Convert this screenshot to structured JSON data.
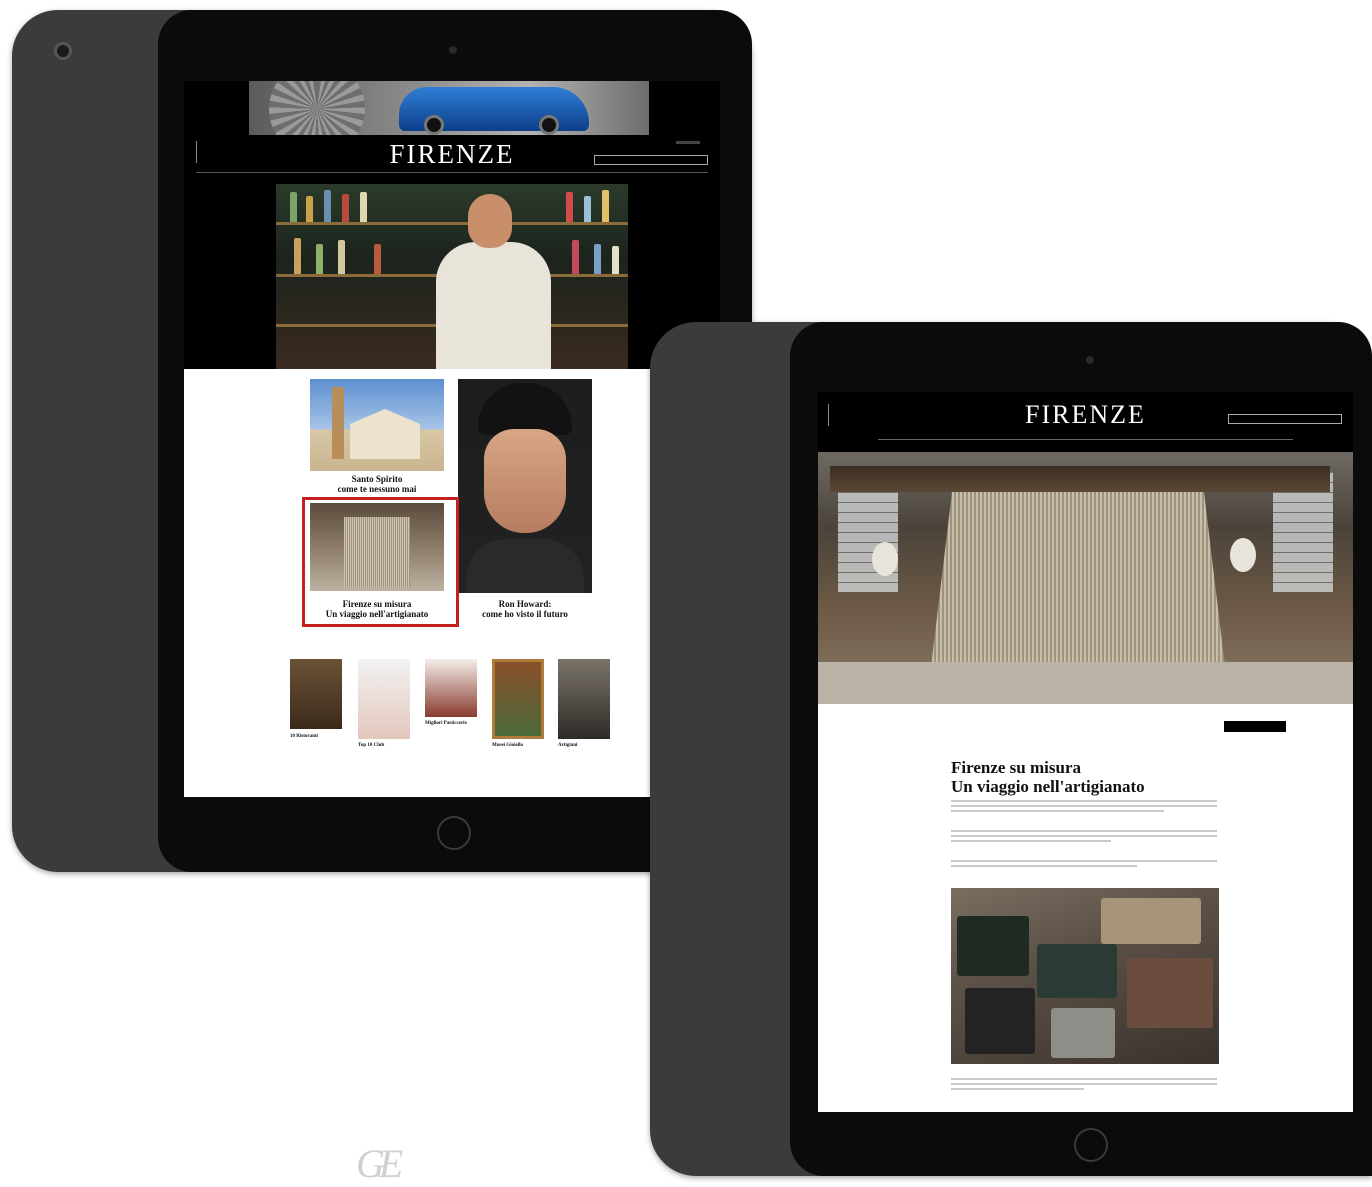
{
  "left_page": {
    "logo": "FIRENZE",
    "cards": [
      {
        "title_line1": "Santo Spirito",
        "title_line2": "come te nessuno mai"
      },
      {
        "title_line1": "Firenze su misura",
        "title_line2": "Un viaggio nell'artigianato"
      },
      {
        "title_line1": "Ron Howard:",
        "title_line2": "come ho visto il futuro"
      }
    ],
    "small_cards": [
      {
        "title": "10 Ristoranti"
      },
      {
        "title": "Top 10 Club"
      },
      {
        "title": "Migliori Pasticcerie"
      },
      {
        "title": "Musei Gioiello"
      },
      {
        "title": "Artigiani"
      }
    ]
  },
  "right_page": {
    "logo": "FIRENZE",
    "article_title_line1": "Firenze su misura",
    "article_title_line2": "Un viaggio nell'artigianato"
  },
  "colors": {
    "highlight": "#c3201e",
    "device": "#3b3b3d",
    "header": "#000000"
  }
}
